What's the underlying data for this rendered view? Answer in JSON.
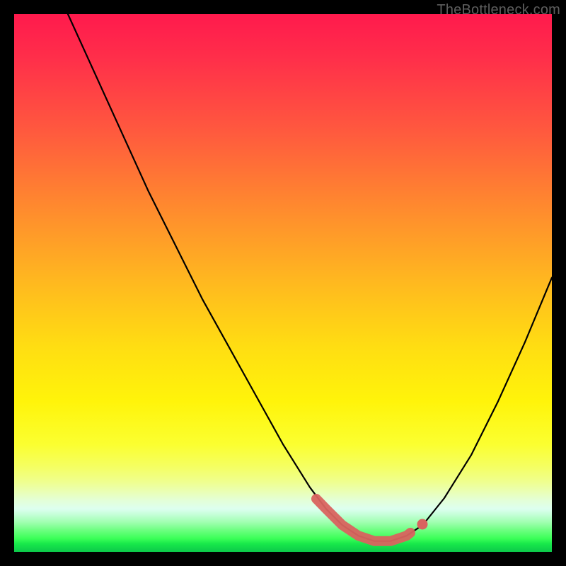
{
  "watermark_text": "TheBottleneck.com",
  "colors": {
    "frame": "#000000",
    "curve": "#000000",
    "optimal_marker": "#d9635f",
    "gradient_top": "#ff1a4d",
    "gradient_mid": "#ffde12",
    "gradient_bottom": "#0cc94a"
  },
  "chart_data": {
    "type": "line",
    "title": "",
    "xlabel": "",
    "ylabel": "",
    "xlim": [
      0,
      100
    ],
    "ylim": [
      0,
      100
    ],
    "grid": false,
    "legend": false,
    "series": [
      {
        "name": "bottleneck-curve",
        "x": [
          10,
          15,
          20,
          25,
          30,
          35,
          40,
          45,
          50,
          55,
          58,
          61,
          64,
          67,
          70,
          73,
          76,
          80,
          85,
          90,
          95,
          100
        ],
        "y": [
          100,
          89,
          78,
          67,
          57,
          47,
          38,
          29,
          20,
          12,
          8,
          5,
          3,
          2,
          2,
          3,
          5,
          10,
          18,
          28,
          39,
          51
        ]
      }
    ],
    "optimal_range_x": [
      56,
      74
    ],
    "annotations": []
  }
}
